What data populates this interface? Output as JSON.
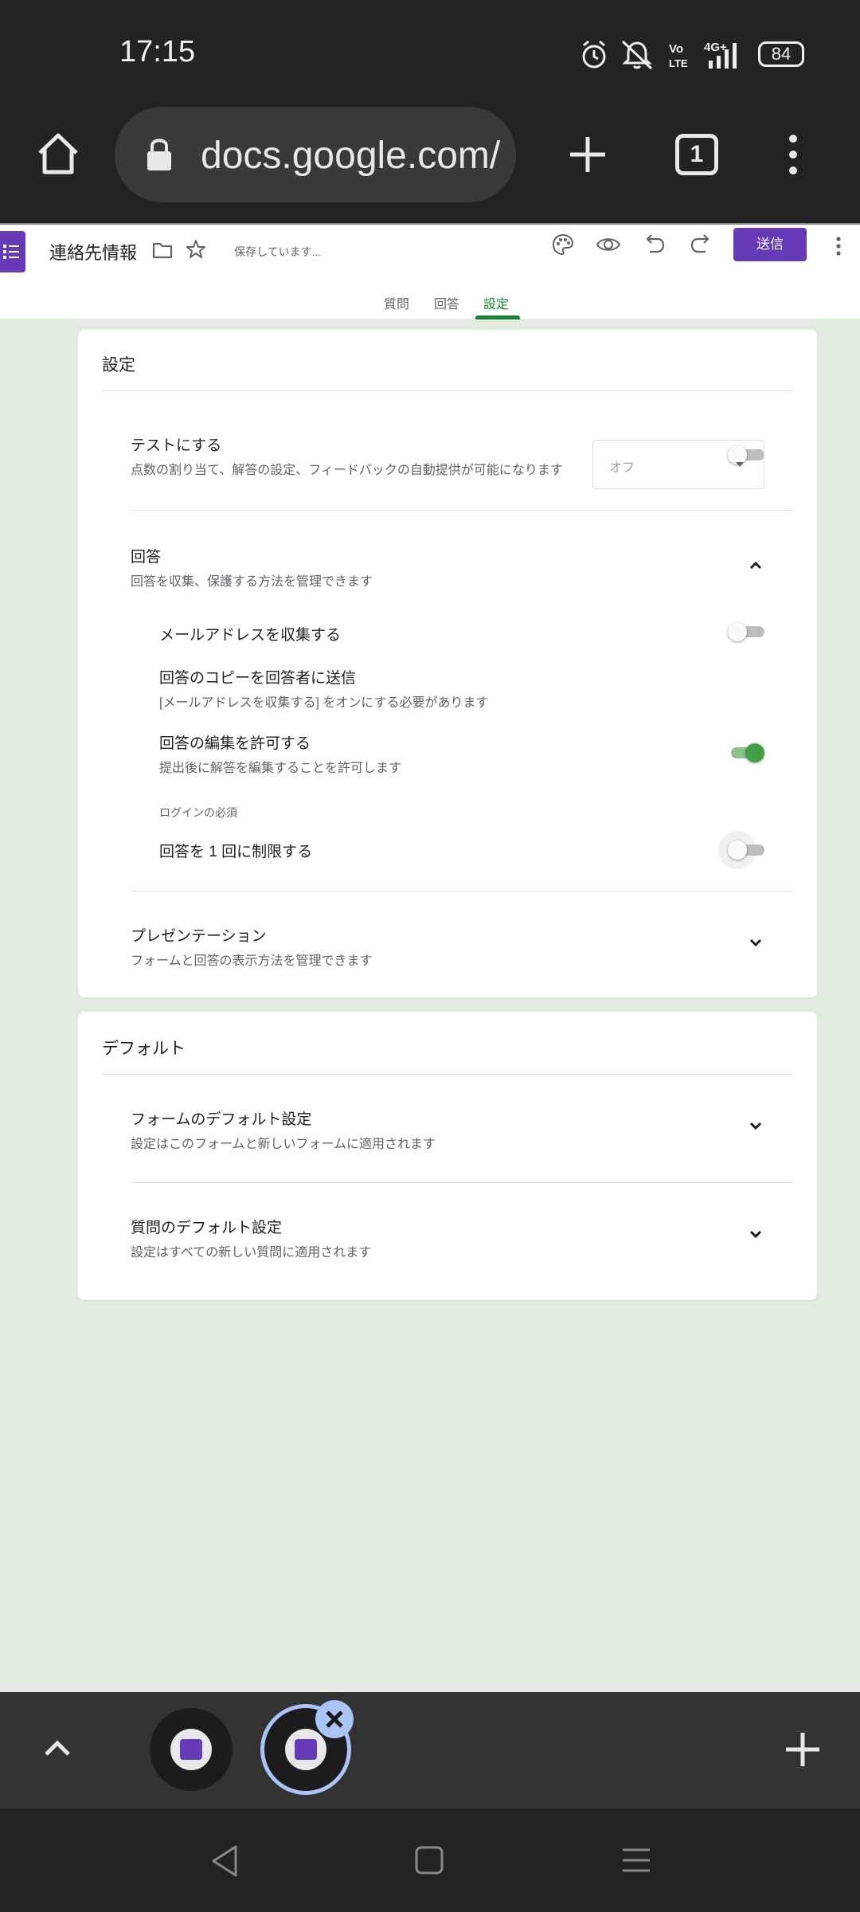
{
  "status_bar": {
    "time": "17:15",
    "battery": "84",
    "network": "4G"
  },
  "browser": {
    "url": "docs.google.com/",
    "tab_count": "1"
  },
  "form": {
    "title": "連絡先情報",
    "save_status": "保存しています...",
    "send_label": "送信",
    "tabs": [
      {
        "label": "質問",
        "active": false
      },
      {
        "label": "回答",
        "active": false
      },
      {
        "label": "設定",
        "active": true
      }
    ]
  },
  "settings_card": {
    "title": "設定",
    "quiz": {
      "label": "テストにする",
      "desc": "点数の割り当て、解答の設定、フィードバックの自動提供が可能になります",
      "enabled": false
    },
    "responses": {
      "label": "回答",
      "desc": "回答を収集、保護する方法を管理できます",
      "collect_email": {
        "label": "メールアドレスを収集する",
        "enabled": false
      },
      "send_copy": {
        "label": "回答のコピーを回答者に送信",
        "desc": "[メールアドレスを収集する] をオンにする必要があります",
        "value": "オフ"
      },
      "allow_edit": {
        "label": "回答の編集を許可する",
        "desc": "提出後に解答を編集することを許可します",
        "enabled": true
      },
      "login_section": "ログインの必須",
      "limit_one": {
        "label": "回答を 1 回に制限する",
        "enabled": false
      }
    },
    "presentation": {
      "label": "プレゼンテーション",
      "desc": "フォームと回答の表示方法を管理できます"
    }
  },
  "defaults_card": {
    "title": "デフォルト",
    "form_defaults": {
      "label": "フォームのデフォルト設定",
      "desc": "設定はこのフォームと新しいフォームに適用されます"
    },
    "question_defaults": {
      "label": "質問のデフォルト設定",
      "desc": "設定はすべての新しい質問に適用されます"
    }
  },
  "colors": {
    "accent": "#673ab7",
    "active_tab": "#188038",
    "toggle_on": "#43a047",
    "background": "#e3ece1"
  }
}
